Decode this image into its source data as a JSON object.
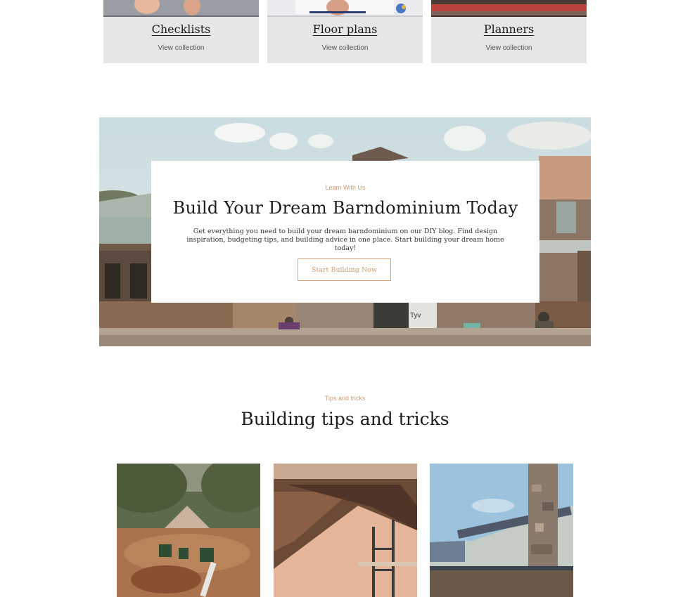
{
  "collections": [
    {
      "title": "Checklists",
      "link": "View collection"
    },
    {
      "title": "Floor plans",
      "link": "View collection"
    },
    {
      "title": "Planners",
      "link": "View collection"
    }
  ],
  "hero": {
    "eyebrow": "Learn With Us",
    "title": "Build Your Dream Barndominium Today",
    "text": "Get everything you need to build your dream barndominium on our DIY blog. Find design inspiration, budgeting tips, and building advice in one place. Start building your dream home today!",
    "button": "Start Building Now",
    "sign_text": "Tyv\nHom"
  },
  "tips": {
    "eyebrow": "Tips and tricks",
    "title": "Building tips and tricks"
  },
  "colors": {
    "accent": "#d39a73",
    "card_bg": "#e6e6e6",
    "heading": "#1d1d1d"
  }
}
